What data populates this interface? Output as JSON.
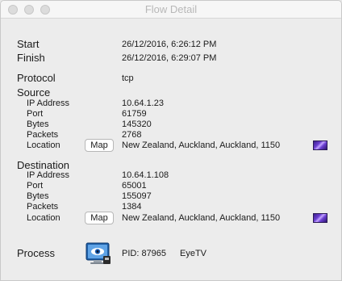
{
  "window": {
    "title": "Flow Detail"
  },
  "labels": {
    "start": "Start",
    "finish": "Finish",
    "protocol": "Protocol",
    "source": "Source",
    "destination": "Destination",
    "process": "Process",
    "ip": "IP Address",
    "port": "Port",
    "bytes": "Bytes",
    "packets": "Packets",
    "location": "Location",
    "map": "Map"
  },
  "flow": {
    "start": "26/12/2016, 6:26:12 PM",
    "finish": "26/12/2016, 6:29:07 PM",
    "protocol": "tcp"
  },
  "source": {
    "ip": "10.64.1.23",
    "port": "61759",
    "bytes": "145320",
    "packets": "2768",
    "location": "New Zealand, Auckland, Auckland, 1150"
  },
  "destination": {
    "ip": "10.64.1.108",
    "port": "65001",
    "bytes": "155097",
    "packets": "1384",
    "location": "New Zealand, Auckland, Auckland, 1150"
  },
  "process": {
    "pid": "PID: 87965",
    "name": "EyeTV",
    "icon": "eyetv-app-icon"
  },
  "colors": {
    "flag": "#5a36c4"
  }
}
